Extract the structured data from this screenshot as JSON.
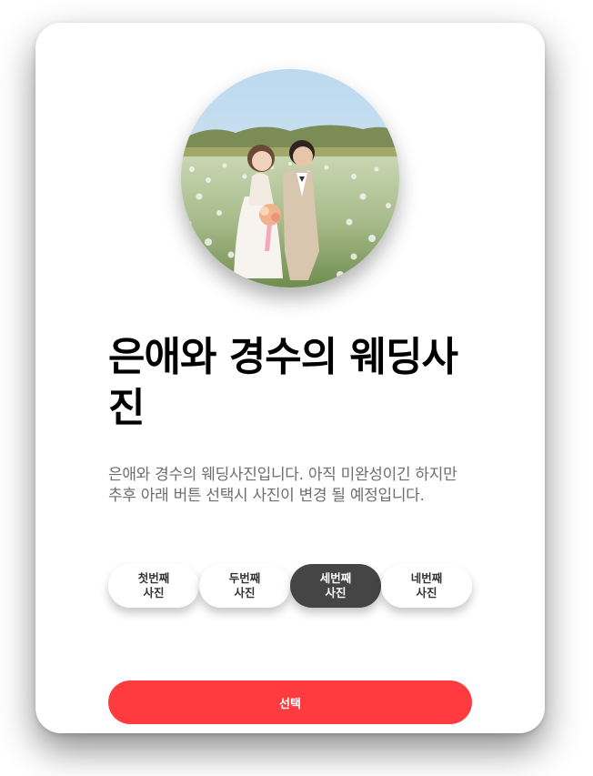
{
  "card": {
    "title": "은애와 경수의 웨딩사진",
    "description": "은애와 경수의 웨딩사진입니다. 아직 미완성이긴 하지만 추후 아래 버튼 선택시 사진이 변경 될 예정입니다.",
    "photo_alt": "wedding-photo",
    "options": [
      {
        "label": "첫번째 사진",
        "selected": false
      },
      {
        "label": "두번째 사진",
        "selected": false
      },
      {
        "label": "세번째 사진",
        "selected": true
      },
      {
        "label": "네번째 사진",
        "selected": false
      }
    ],
    "select_label": "선택"
  },
  "colors": {
    "accent": "#ff3b3f",
    "selected_option": "#454545",
    "description_text": "#6e6e6e"
  }
}
